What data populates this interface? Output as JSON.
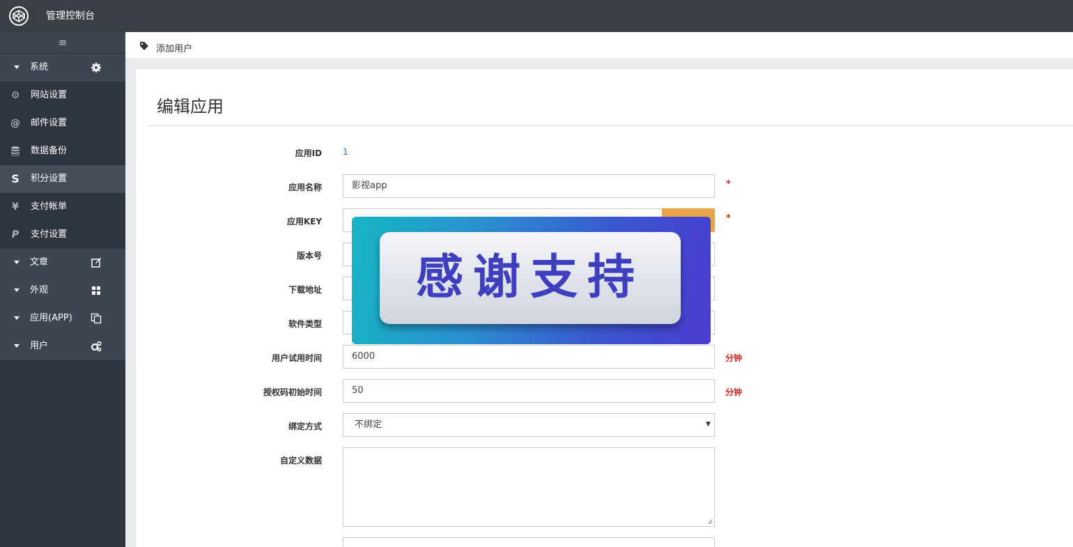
{
  "app": {
    "title": "管理控制台",
    "logo_icon": "codepen-logo-icon"
  },
  "sidebar": {
    "toggle_icon": "hamburger-icon",
    "groups": [
      {
        "label": "系统",
        "icon": "gear-icon",
        "items": [
          {
            "label": "网站设置",
            "icon": "gear-icon"
          },
          {
            "label": "邮件设置",
            "icon": "at-icon"
          },
          {
            "label": "数据备份",
            "icon": "database-icon"
          },
          {
            "label": "积分设置",
            "icon": "s-icon",
            "active": true
          },
          {
            "label": "支付帐单",
            "icon": "yen-icon"
          },
          {
            "label": "支付设置",
            "icon": "paypal-icon"
          }
        ]
      },
      {
        "label": "文章",
        "icon": "edit-icon"
      },
      {
        "label": "外观",
        "icon": "grid-icon"
      },
      {
        "label": "应用(APP)",
        "icon": "copy-icon"
      },
      {
        "label": "用户",
        "icon": "cogs-icon"
      }
    ]
  },
  "breadcrumb": {
    "label": "添加用户",
    "icon": "tag-icon"
  },
  "panel": {
    "title": "编辑应用"
  },
  "form": {
    "app_id": {
      "label": "应用ID",
      "value": "1"
    },
    "app_name": {
      "label": "应用名称",
      "value": "影视app",
      "required_mark": "*"
    },
    "app_key": {
      "label": "应用KEY",
      "required_mark": "*"
    },
    "version": {
      "label": "版本号"
    },
    "download_url": {
      "label": "下载地址"
    },
    "software_type": {
      "label": "软件类型"
    },
    "trial_time": {
      "label": "用户试用时间",
      "value": "6000",
      "unit": "分钟"
    },
    "auth_init_time": {
      "label": "授权码初始时间",
      "value": "50",
      "unit": "分钟"
    },
    "bind_mode": {
      "label": "绑定方式",
      "value": "不绑定"
    },
    "custom_data": {
      "label": "自定义数据",
      "value": ""
    }
  },
  "overlay": {
    "text": "感谢支持"
  },
  "colors": {
    "topbar": "#3a3f46",
    "sidebar": "#2f3540",
    "accent_orange": "#e8a447",
    "required_red": "#d9231c"
  }
}
